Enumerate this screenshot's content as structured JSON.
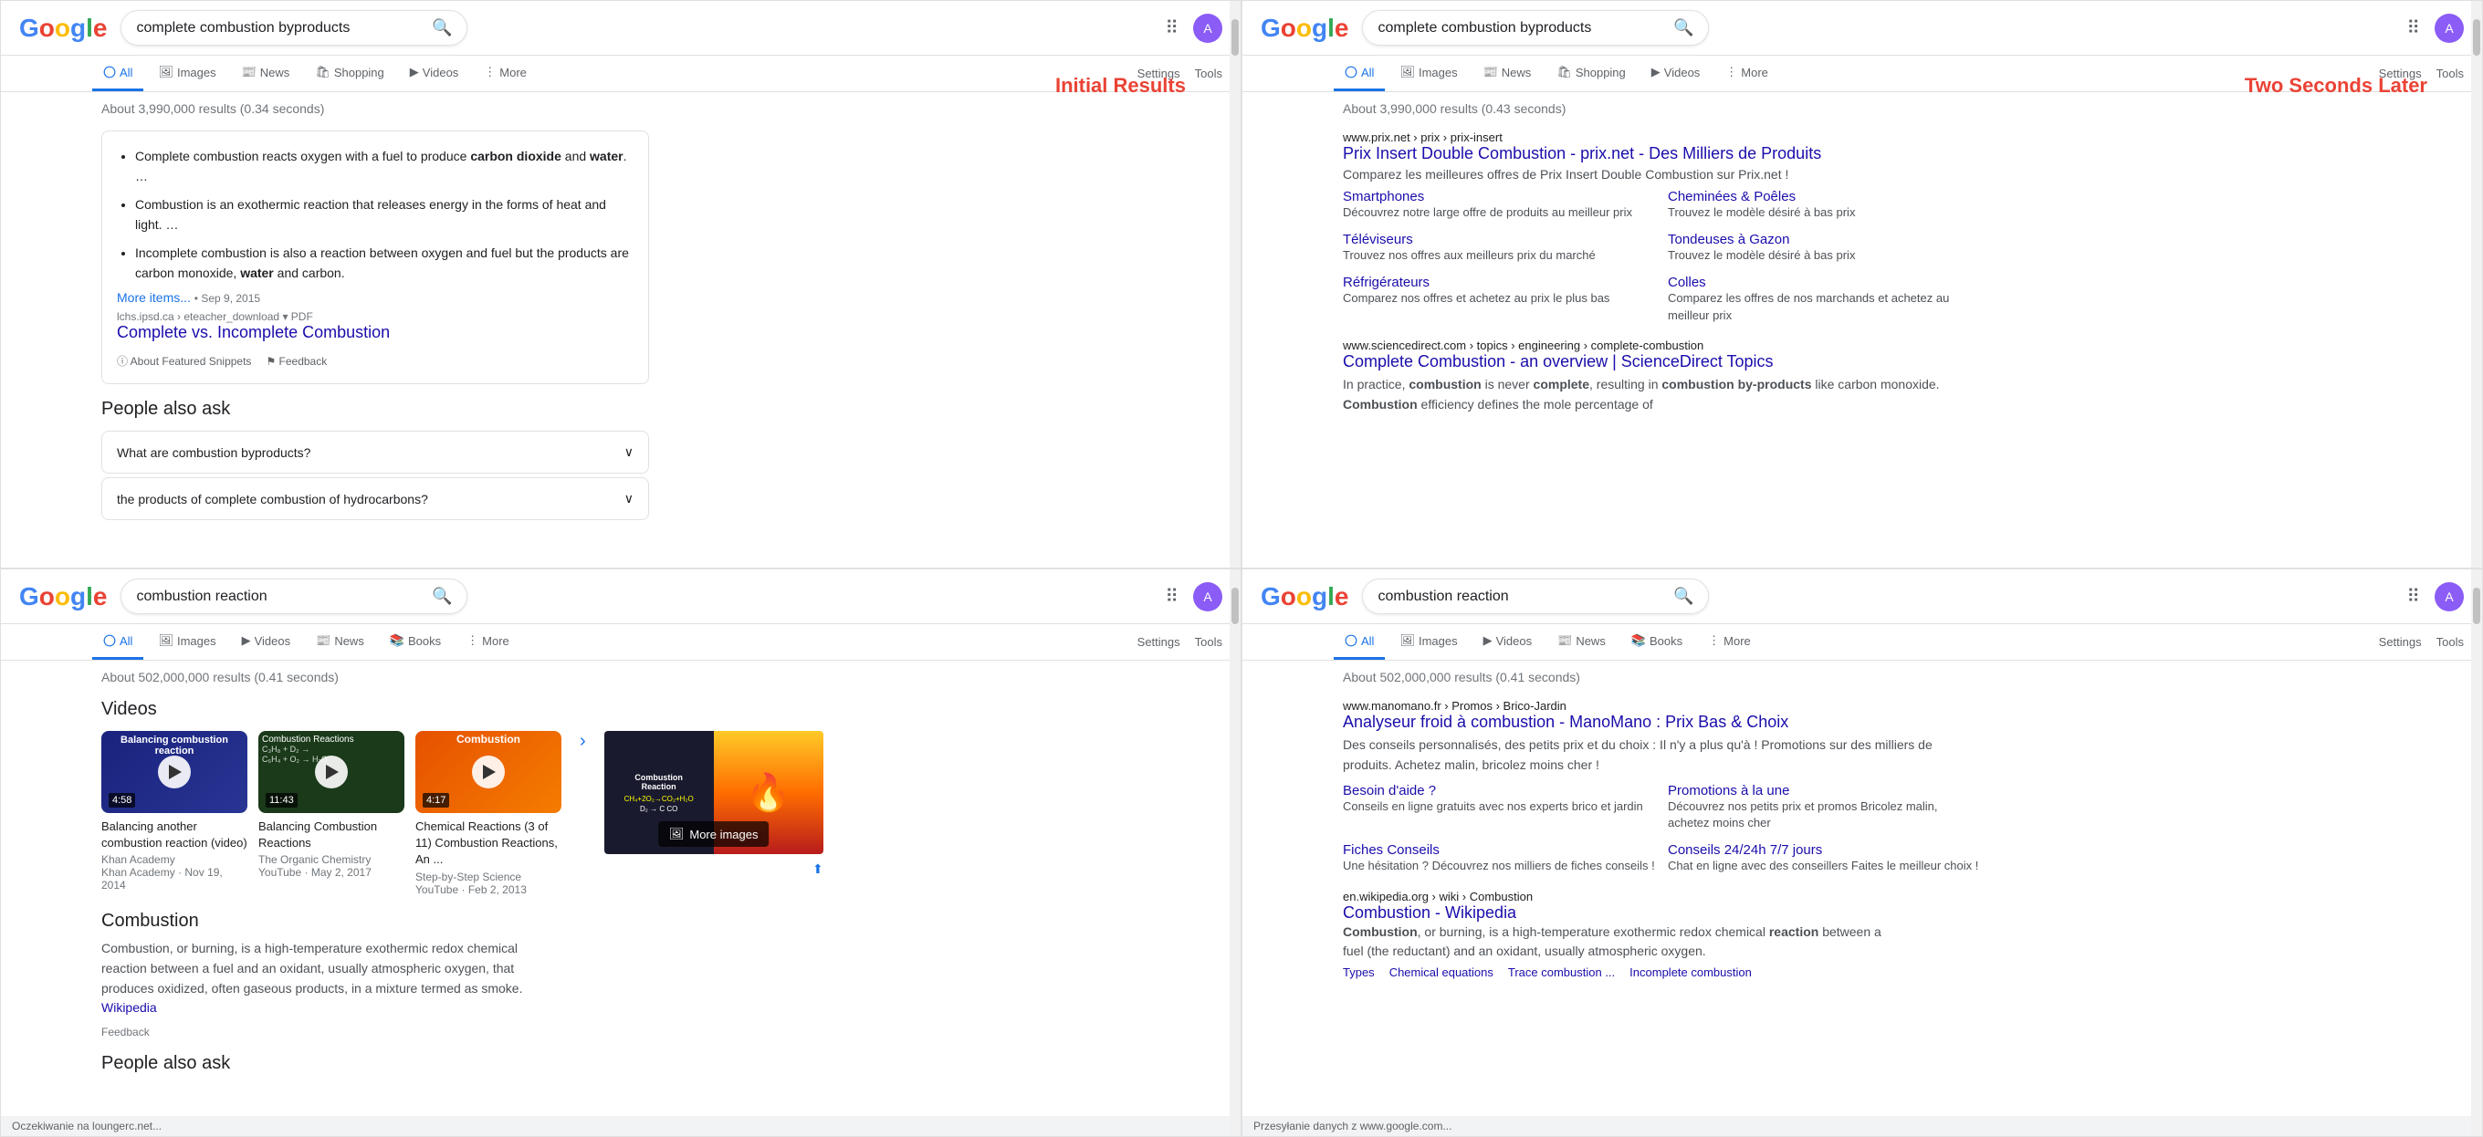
{
  "panels": [
    {
      "id": "top-left",
      "query": "complete combustion byproducts",
      "label": "Initial Results",
      "label_color": "#EA4335",
      "results_count": "About 3,990,000 results (0.34 seconds)",
      "tabs": [
        {
          "label": "All",
          "icon": "circle",
          "active": true
        },
        {
          "label": "Images",
          "icon": "image"
        },
        {
          "label": "News",
          "icon": "newspaper"
        },
        {
          "label": "Shopping",
          "icon": "cart"
        },
        {
          "label": "Videos",
          "icon": "video"
        },
        {
          "label": "More",
          "icon": "dots"
        }
      ],
      "settings_label": "Settings",
      "tools_label": "Tools",
      "featured_snippet": {
        "bullets": [
          "Complete combustion reacts oxygen with a fuel to produce carbon dioxide and water. ...",
          "Combustion is an exothermic reaction that releases energy in the forms of heat and light. ...",
          "Incomplete combustion is also a reaction between oxygen and fuel but the products are carbon monoxide, water and carbon."
        ],
        "more_link": "More items...",
        "source_date": "Sep 9, 2015",
        "source_domain": "lchs.ipsd.ca › eteacher_download",
        "source_format": "PDF",
        "result_title": "Complete vs. Incomplete Combustion",
        "about_label": "About Featured Snippets",
        "feedback_label": "Feedback"
      },
      "paa": {
        "title": "People also ask",
        "question": "What are combustion byproducts?",
        "sub_question": "the products of complete combustion of hydrocarbons?"
      }
    },
    {
      "id": "top-right",
      "query": "complete combustion byproducts",
      "label": "Two Seconds Later",
      "label_color": "#EA4335",
      "results_count": "About 3,990,000 results (0.43 seconds)",
      "tabs": [
        {
          "label": "All",
          "icon": "circle",
          "active": true
        },
        {
          "label": "Images",
          "icon": "image"
        },
        {
          "label": "News",
          "icon": "newspaper"
        },
        {
          "label": "Shopping",
          "icon": "cart"
        },
        {
          "label": "Videos",
          "icon": "video"
        },
        {
          "label": "More",
          "icon": "dots"
        }
      ],
      "settings_label": "Settings",
      "tools_label": "Tools",
      "ad_result": {
        "url": "www.prix.net › prix › prix-insert",
        "title": "Prix Insert Double Combustion - prix.net - Des Milliers de Produits",
        "desc": "Comparez les meilleures offres de Prix Insert Double Combustion sur Prix.net !",
        "items": [
          {
            "title": "Smartphones",
            "desc": "Découvrez notre large offre de produits au meilleur prix"
          },
          {
            "title": "Cheminées & Poêles",
            "desc": "Trouvez le modèle désiré à bas prix"
          },
          {
            "title": "Téléviseurs",
            "desc": "Trouvez nos offres aux meilleurs prix du marché"
          },
          {
            "title": "Tondeuses à Gazon",
            "desc": "Trouvez le modèle désiré à bas prix"
          },
          {
            "title": "Réfrigérateurs",
            "desc": "Comparez nos offres et achetez au prix le plus bas"
          },
          {
            "title": "Colles",
            "desc": "Comparez les offres de nos marchands et achetez au meilleur prix"
          }
        ]
      },
      "organic_result": {
        "url": "www.sciencedirect.com › topics › engineering › complete-combustion",
        "title": "Complete Combustion - an overview | ScienceDirect Topics",
        "snippet": "In practice, combustion is never complete, resulting in combustion by-products like carbon monoxide. Combustion efficiency defines the mole percentage of"
      }
    },
    {
      "id": "bottom-left",
      "query": "combustion reaction",
      "results_count": "About 502,000,000 results (0.41 seconds)",
      "tabs": [
        {
          "label": "All",
          "icon": "circle",
          "active": true
        },
        {
          "label": "Images",
          "icon": "image"
        },
        {
          "label": "Videos",
          "icon": "video"
        },
        {
          "label": "News",
          "icon": "newspaper"
        },
        {
          "label": "Books",
          "icon": "book"
        },
        {
          "label": "More",
          "icon": "dots"
        }
      ],
      "settings_label": "Settings",
      "tools_label": "Tools",
      "videos_section": {
        "title": "Videos",
        "items": [
          {
            "thumb_style": "thumb-blue",
            "title_overlay": "Balancing combustion reaction",
            "duration": "4:58",
            "title": "Balancing another combustion reaction (video)",
            "channel": "Khan Academy",
            "publisher": "Khan Academy",
            "date": "Nov 19, 2014"
          },
          {
            "thumb_style": "thumb-chem",
            "title_overlay": "Combustion Reactions",
            "duration": "11:43",
            "title": "Balancing Combustion Reactions",
            "channel": "The Organic Chemistry",
            "publisher": "YouTube",
            "date": "May 2, 2017"
          },
          {
            "thumb_style": "thumb-orange",
            "title_overlay": "Combustion",
            "duration": "4:17",
            "title": "Chemical Reactions (3 of 11) Combustion Reactions, An ...",
            "channel": "Step-by-Step Science",
            "publisher": "YouTube",
            "date": "Feb 2, 2013"
          }
        ]
      },
      "large_video": {
        "title": "Combustion",
        "text": "Combustion, or burning, is a high-temperature exothermic redox chemical reaction between a fuel and an oxidant, usually atmospheric oxygen, that produces oxidized, often gaseous products, in a mixture termed as smoke.",
        "wiki_text": "Wikipedia",
        "feedback_label": "Feedback",
        "more_images_label": "More images"
      },
      "paa": {
        "title": "People also ask"
      }
    },
    {
      "id": "bottom-right",
      "query": "combustion reaction",
      "results_count": "About 502,000,000 results (0.41 seconds)",
      "tabs": [
        {
          "label": "All",
          "icon": "circle",
          "active": true
        },
        {
          "label": "Images",
          "icon": "image"
        },
        {
          "label": "Videos",
          "icon": "video"
        },
        {
          "label": "News",
          "icon": "newspaper"
        },
        {
          "label": "Books",
          "icon": "book"
        },
        {
          "label": "More",
          "icon": "dots"
        }
      ],
      "settings_label": "Settings",
      "tools_label": "Tools",
      "manomano": {
        "url": "www.manomano.fr › Promos › Brico-Jardin",
        "title": "Analyseur froid à combustion - ManoMano : Prix Bas & Choix",
        "desc": "Des conseils personnalisés, des petits prix et du choix : Il n'y a plus qu'à ! Promotions sur des milliers de produits. Achetez malin, bricolez moins cher !",
        "items": [
          {
            "title": "Besoin d'aide ?",
            "desc": "Conseils en ligne gratuits avec nos experts brico et jardin"
          },
          {
            "title": "Promotions à la une",
            "desc": "Découvrez nos petits prix et promos Bricolez malin, achetez moins cher"
          },
          {
            "title": "Fiches Conseils",
            "desc": "Une hésitation ? Découvrez nos milliers de fiches conseils !"
          },
          {
            "title": "Conseils 24/24h 7/7 jours",
            "desc": "Chat en ligne avec des conseillers Faites le meilleur choix !"
          }
        ]
      },
      "wikipedia": {
        "url": "en.wikipedia.org › wiki › Combustion",
        "title": "Combustion - Wikipedia",
        "snippet": "Combustion, or burning, is a high-temperature exothermic redox chemical reaction between a fuel (the reductant) and an oxidant, usually atmospheric oxygen.",
        "sub_links": [
          "Types",
          "Chemical equations",
          "Trace combustion ...",
          "Incomplete combustion"
        ]
      }
    }
  ],
  "status_bar": "Oczekiwanie na loungerc.net...",
  "status_bar2": "Przesyłanie danych z www.google.com..."
}
